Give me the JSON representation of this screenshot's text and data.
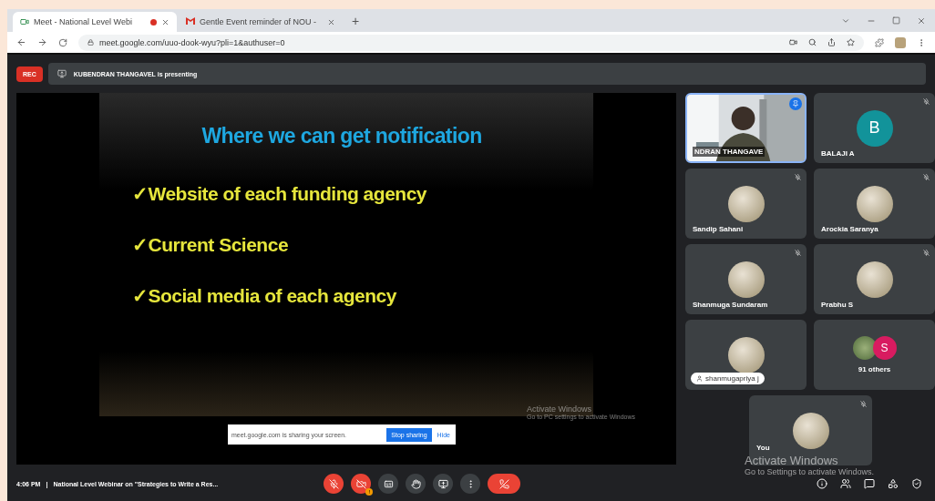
{
  "browser": {
    "tabs": [
      {
        "title": "Meet - National Level Webi",
        "recording": true,
        "selected": true
      },
      {
        "title": "Gentle Event reminder of NOU -",
        "recording": false,
        "selected": false
      }
    ],
    "new_tab": "+",
    "url": "meet.google.com/uuo-dook-wyu?pli=1&authuser=0"
  },
  "meet": {
    "rec_badge": "REC",
    "presenting": "KUBENDRAN THANGAVEL is presenting",
    "slide": {
      "title": "Where we can get notification",
      "bullets": [
        "✓Website of each funding agency",
        "✓Current Science",
        "✓Social media of each agency"
      ],
      "share_bar": {
        "message": "meet.google.com is sharing your screen.",
        "stop": "Stop sharing",
        "hide": "Hide"
      },
      "watermark": {
        "title": "Activate Windows",
        "text": "Go to PC settings to activate Windows"
      }
    },
    "tiles": [
      {
        "kind": "video",
        "name": "NDRAN THANGAVE",
        "speaking": true,
        "muted": false
      },
      {
        "kind": "letter",
        "name": "BALAJI A",
        "letter": "B",
        "color": "#12939a",
        "speaking": false,
        "muted": true
      },
      {
        "name": "Sandip Sahani",
        "speaking": false,
        "muted": true
      },
      {
        "name": "Arockia Saranya",
        "speaking": false,
        "muted": true
      },
      {
        "name": "Shanmuga Sundaram",
        "speaking": false,
        "muted": true
      },
      {
        "name": "Prabhu S",
        "speaking": false,
        "muted": true
      },
      {
        "kind": "pill",
        "name": "shanmugapriya j",
        "speaking": false,
        "muted": false
      },
      {
        "kind": "others",
        "name": "91 others",
        "letter": "S",
        "color": "#d81b60",
        "speaking": false,
        "muted": false
      }
    ],
    "self_tile": {
      "name": "You",
      "muted": true
    },
    "os_watermark": {
      "title": "Activate Windows",
      "text": "Go to Settings to activate Windows."
    },
    "time": "4:06 PM",
    "separator": "|",
    "meeting_title": "National Level Webinar on \"Strategies to Write a Res...",
    "controls": [
      {
        "kind": "mic",
        "on": false
      },
      {
        "kind": "camera",
        "on": false,
        "alert": "!"
      },
      {
        "kind": "captions",
        "on": true
      },
      {
        "kind": "hand",
        "on": true
      },
      {
        "kind": "present",
        "on": true
      },
      {
        "kind": "more",
        "on": true
      },
      {
        "kind": "end"
      }
    ]
  }
}
